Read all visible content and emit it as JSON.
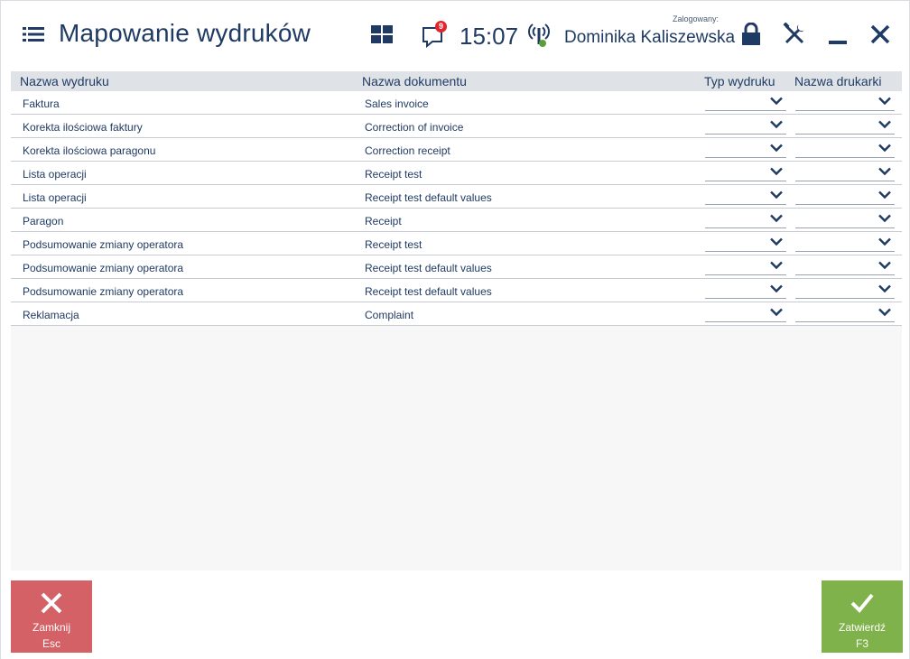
{
  "header": {
    "title": "Mapowanie wydruków",
    "notifications_count": "9",
    "clock": "15:07",
    "logged_label": "Zalogowany:",
    "user_name": "Dominika Kaliszewska"
  },
  "table": {
    "columns": [
      "Nazwa wydruku",
      "Nazwa dokumentu",
      "Typ wydruku",
      "Nazwa drukarki"
    ],
    "rows": [
      {
        "print_name": "Faktura",
        "document_name": "Sales invoice"
      },
      {
        "print_name": "Korekta ilościowa faktury",
        "document_name": "Correction of invoice"
      },
      {
        "print_name": "Korekta ilościowa paragonu",
        "document_name": "Correction receipt"
      },
      {
        "print_name": "Lista operacji",
        "document_name": "Receipt test"
      },
      {
        "print_name": "Lista operacji",
        "document_name": "Receipt test default values"
      },
      {
        "print_name": "Paragon",
        "document_name": "Receipt"
      },
      {
        "print_name": "Podsumowanie zmiany operatora",
        "document_name": "Receipt test"
      },
      {
        "print_name": "Podsumowanie zmiany operatora",
        "document_name": "Receipt test default values"
      },
      {
        "print_name": "Podsumowanie zmiany operatora",
        "document_name": "Receipt test default values"
      },
      {
        "print_name": "Reklamacja",
        "document_name": "Complaint"
      }
    ]
  },
  "footer": {
    "close_label": "Zamknij",
    "close_key": "Esc",
    "confirm_label": "Zatwierdź",
    "confirm_key": "F3"
  },
  "colors": {
    "text": "#1f3b63",
    "header_bg": "#dfe3e8",
    "close_button": "#d36165",
    "confirm_button": "#7fb24b",
    "badge": "#e0252d",
    "signal_dot": "#5a9e3a"
  }
}
